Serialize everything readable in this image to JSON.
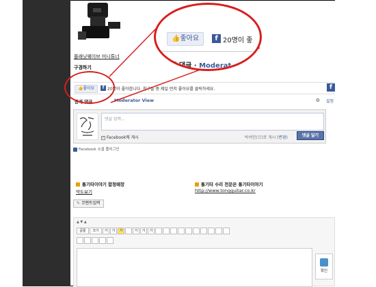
{
  "product": {
    "link_text": "플래닛웨이브 미니튜너",
    "price_label": "구경하기"
  },
  "like_bar": {
    "like_button": "좋아요",
    "fb_letter": "f",
    "like_text": "20명이 좋아합니다. 친구들 중 제일 먼저 좋아요를 클릭하세요."
  },
  "comments": {
    "title": "공개 댓글",
    "moderator_link": "Moderator View",
    "settings": "설정",
    "input_placeholder": "댓글 입력...",
    "fb_post_label": "Facebook에 게시",
    "posting_as": "박석민(으)로 게시",
    "change_link": "(변경)",
    "post_button": "댓글 달기",
    "plugin_label": "Facebook 소셜 플러그인"
  },
  "zoom": {
    "like_button": "좋아요",
    "fb_letter": "f",
    "like_text": "20명이 좋",
    "title": "공개 댓글",
    "moderator": "Moderat"
  },
  "banner": {
    "left_title": "통기타이야기 합정매장",
    "left_link": "약도보기",
    "right_title": "통기타 수리 전문은 통기타이야기",
    "right_link": "http://www.tongguitar.co.kr"
  },
  "editor": {
    "comment_input_button": "코멘트입력",
    "mini_controls": "▲ ▼ ▲",
    "toolbar1": [
      "글꼴",
      "크기",
      "가",
      "가",
      "가",
      "",
      "가",
      "가",
      "가",
      "",
      "",
      "",
      "",
      "",
      "",
      "",
      "",
      "",
      ""
    ],
    "toolbar2": [
      "",
      "",
      "",
      "",
      ""
    ],
    "confirm_label": "확인"
  },
  "colors": {
    "facebook_blue": "#3b5998",
    "callout_red": "#d71e1e",
    "dark_column": "#2d2d2d"
  }
}
